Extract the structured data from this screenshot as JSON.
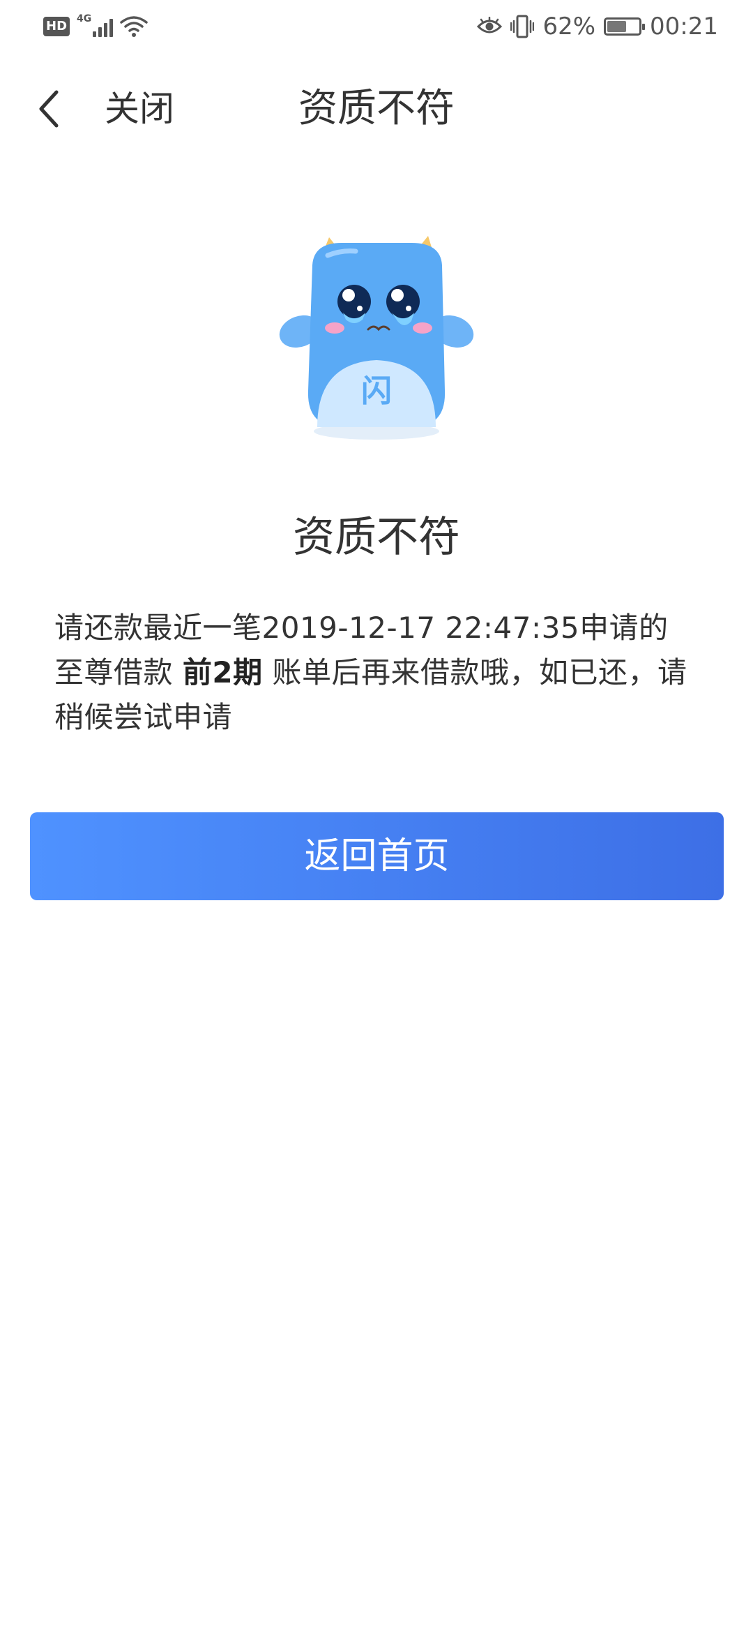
{
  "status_bar": {
    "hd_label": "HD",
    "network_label": "4G",
    "battery_percent": "62%",
    "battery_level": 0.62,
    "time": "00:21",
    "icons": [
      "eye-comfort-icon",
      "vibrate-icon",
      "battery-icon",
      "signal-icon",
      "wifi-icon"
    ]
  },
  "nav": {
    "back_icon": "chevron-left-icon",
    "close_label": "关闭",
    "title": "资质不符"
  },
  "content": {
    "mascot": "crying-blue-mascot",
    "mascot_badge": "闪",
    "result_title": "资质不符",
    "message_part1": "请还款最近一笔2019-12-17 22:47:35申请的至尊借款 ",
    "message_bold": "前2期",
    "message_part2": " 账单后再来借款哦，如已还，请稍候尝试申请"
  },
  "button": {
    "label": "返回首页"
  },
  "colors": {
    "button_start": "#4f92ff",
    "button_end": "#3d6fe6",
    "mascot_body": "#5aaaf5",
    "text": "#333333"
  }
}
